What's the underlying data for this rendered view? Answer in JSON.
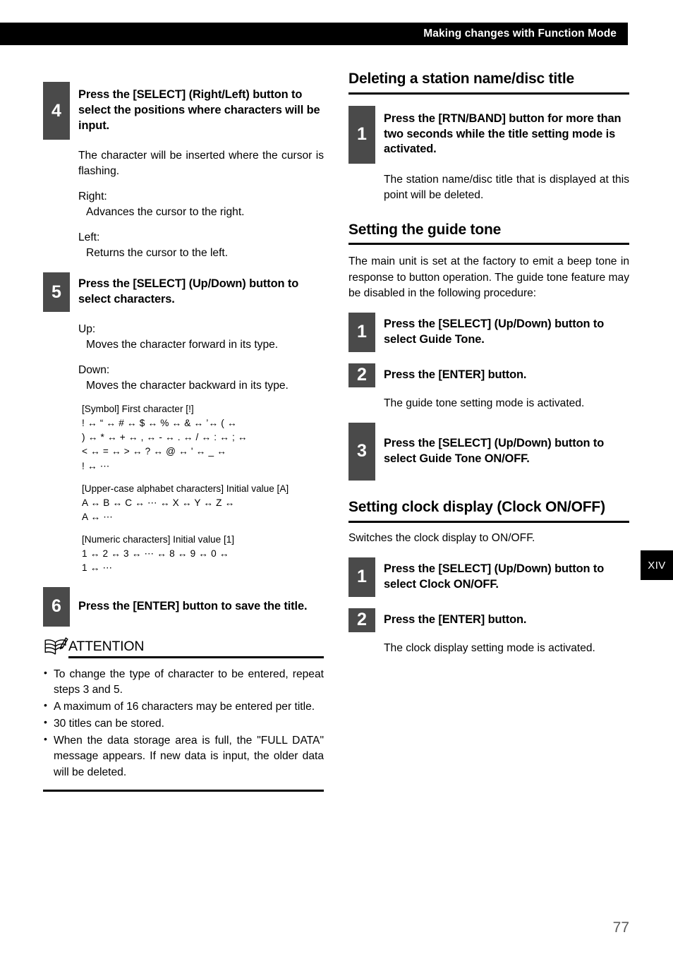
{
  "header": {
    "title": "Making changes with Function Mode"
  },
  "left_column": {
    "step4": {
      "number": "4",
      "title": "Press the [SELECT] (Right/Left) button to select the positions where characters will be input.",
      "body": "The character will be inserted where the cursor is flashing.",
      "definitions": [
        {
          "term": "Right:",
          "desc": "Advances the cursor to the right."
        },
        {
          "term": "Left:",
          "desc": "Returns the cursor to the left."
        }
      ]
    },
    "step5": {
      "number": "5",
      "title": "Press the [SELECT] (Up/Down) button to select characters.",
      "definitions": [
        {
          "term": "Up:",
          "desc": "Moves the character forward in its type."
        },
        {
          "term": "Down:",
          "desc": "Moves the character backward in its type."
        }
      ],
      "char_groups": [
        {
          "label": "[Symbol] First character [!]",
          "lines": [
            "! ↔ “ ↔ # ↔ $ ↔ % ↔ & ↔ ’↔ ( ↔",
            ") ↔ * ↔ + ↔ , ↔ - ↔ . ↔ / ↔ : ↔ ; ↔",
            "< ↔ = ↔ > ↔ ? ↔ @ ↔ ' ↔ _ ↔",
            "! ↔ ⋯"
          ]
        },
        {
          "label": "[Upper-case alphabet characters] Initial value [A]",
          "lines": [
            "A ↔ B ↔ C ↔ ⋯ ↔ X ↔ Y ↔ Z ↔",
            "A ↔ ⋯"
          ]
        },
        {
          "label": "[Numeric characters] Initial value [1]",
          "lines": [
            "1 ↔ 2 ↔ 3 ↔ ⋯ ↔ 8 ↔ 9 ↔ 0 ↔",
            "1 ↔ ⋯"
          ]
        }
      ]
    },
    "step6": {
      "number": "6",
      "title": "Press the [ENTER] button to save the title."
    },
    "attention": {
      "label": "ATTENTION",
      "items": [
        "To change the type of character to be entered, repeat steps 3 and 5.",
        "A maximum of 16 characters may be entered per title.",
        "30 titles can be stored.",
        "When the data storage area is full, the \"FULL DATA\" message appears. If new data is input, the older data will be deleted."
      ]
    }
  },
  "right_column": {
    "section_delete": {
      "heading": "Deleting a station name/disc title",
      "step1": {
        "number": "1",
        "title": "Press the [RTN/BAND] button for more than two seconds while the title setting mode is activated.",
        "body": "The station name/disc title that is displayed at this point will be deleted."
      }
    },
    "section_guide_tone": {
      "heading": "Setting the guide tone",
      "intro": "The main unit is set at the factory to emit a beep tone in response to button operation. The guide tone feature may be disabled in the following procedure:",
      "step1": {
        "number": "1",
        "title": "Press the [SELECT] (Up/Down) button to select Guide Tone."
      },
      "step2": {
        "number": "2",
        "title": "Press the [ENTER] button.",
        "body": "The guide tone setting mode is activated."
      },
      "step3": {
        "number": "3",
        "title": "Press the [SELECT] (Up/Down) button to select Guide Tone ON/OFF."
      }
    },
    "section_clock": {
      "heading": "Setting clock display (Clock ON/OFF)",
      "intro": "Switches the clock display to ON/OFF.",
      "step1": {
        "number": "1",
        "title": "Press the [SELECT] (Up/Down) button to select Clock ON/OFF."
      },
      "step2": {
        "number": "2",
        "title": "Press the [ENTER] button.",
        "body": "The clock display setting mode is activated."
      }
    }
  },
  "side_tab": {
    "label": "XIV"
  },
  "folio": {
    "page_number": "77"
  },
  "colors": {
    "header_bar": "#000000",
    "step_badge": "#4a4a4a",
    "rule": "#000000",
    "folio": "#5b5b5b"
  }
}
